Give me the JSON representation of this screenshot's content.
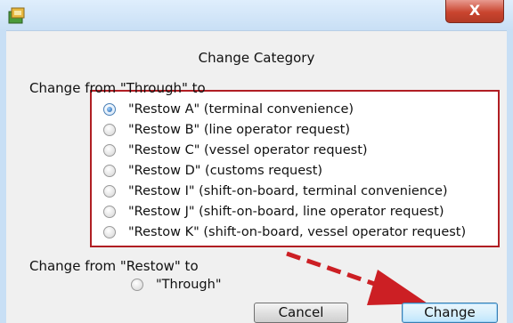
{
  "dialog": {
    "heading": "Change Category",
    "close_glyph": "X"
  },
  "section_from_through": {
    "label": "Change from \"Through\" to",
    "options": [
      {
        "label": "\"Restow A\" (terminal convenience)",
        "selected": true
      },
      {
        "label": "\"Restow B\" (line operator request)",
        "selected": false
      },
      {
        "label": "\"Restow C\" (vessel operator request)",
        "selected": false
      },
      {
        "label": "\"Restow D\" (customs request)",
        "selected": false
      },
      {
        "label": "\"Restow I\" (shift-on-board, terminal convenience)",
        "selected": false
      },
      {
        "label": "\"Restow J\" (shift-on-board, line operator request)",
        "selected": false
      },
      {
        "label": "\"Restow K\" (shift-on-board, vessel operator request)",
        "selected": false
      }
    ]
  },
  "section_from_restow": {
    "label": "Change from \"Restow\" to",
    "option": {
      "label": "\"Through\"",
      "selected": false
    }
  },
  "buttons": {
    "cancel": "Cancel",
    "change": "Change"
  },
  "colors": {
    "highlight_box": "#b01e23",
    "arrow": "#cc1f24",
    "titlebar": "#c8dff5",
    "close_button": "#c9452f"
  }
}
